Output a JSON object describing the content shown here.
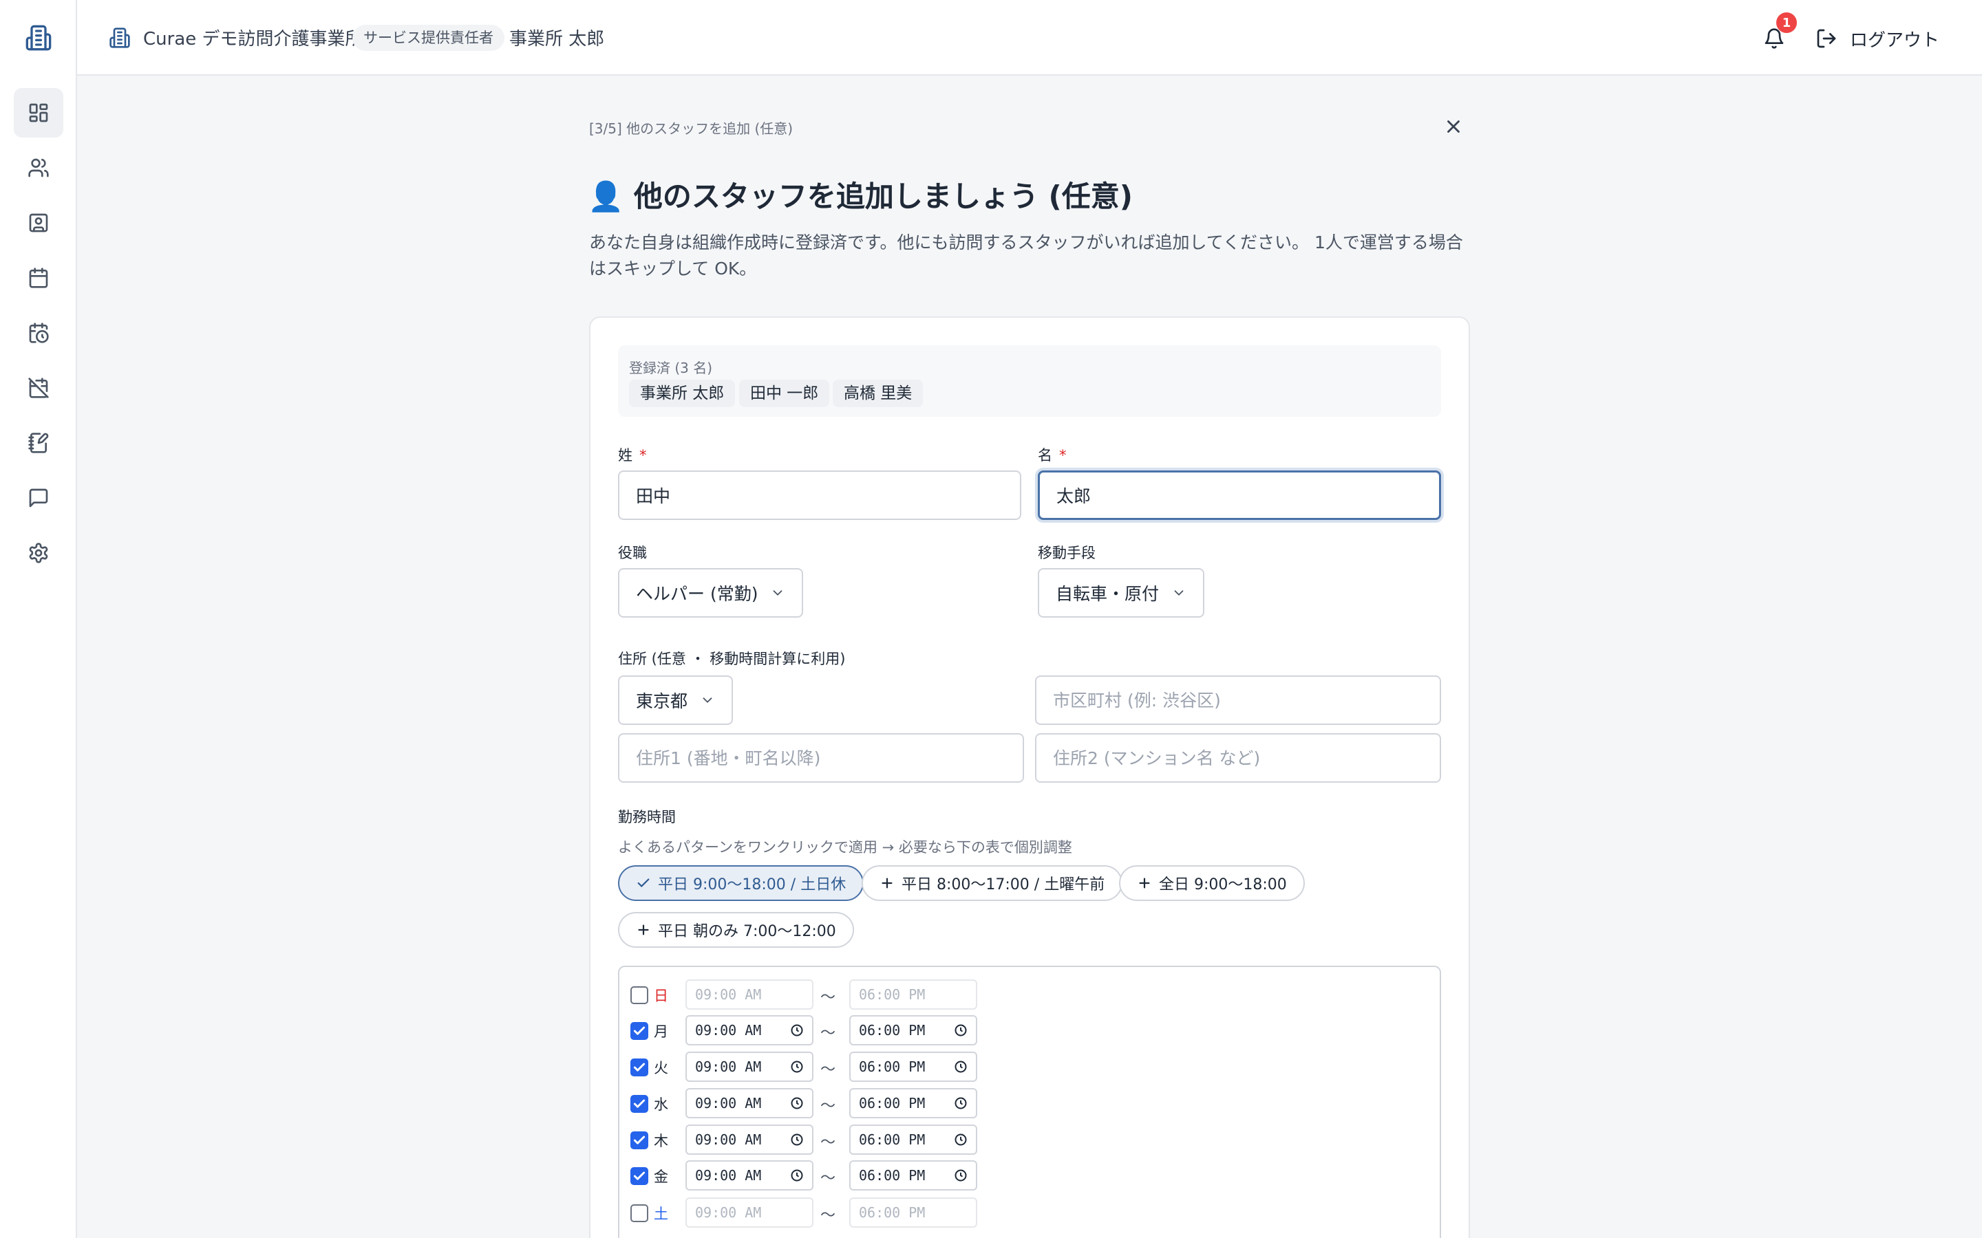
{
  "header": {
    "org_name": "Curae デモ訪問介護事業所",
    "role_badge": "サービス提供責任者",
    "user_name": "事業所 太郎",
    "notification_count": "1",
    "logout_label": "ログアウト"
  },
  "sidebar": {
    "items": [
      {
        "name": "dashboard-icon",
        "active": true
      },
      {
        "name": "users-icon"
      },
      {
        "name": "contact-icon"
      },
      {
        "name": "calendar-icon"
      },
      {
        "name": "calendar-clock-icon"
      },
      {
        "name": "calendar-off-icon"
      },
      {
        "name": "notebook-pen-icon"
      },
      {
        "name": "message-icon"
      },
      {
        "name": "gear-icon"
      }
    ]
  },
  "wizard": {
    "step_label": "[3/5] 他のスタッフを追加 (任意)",
    "title_emoji": "👤",
    "title": "他のスタッフを追加しましょう (任意)",
    "description": "あなた自身は組織作成時に登録済です。他にも訪問するスタッフがいれば追加してください。 1人で運営する場合はスキップして OK。"
  },
  "registered": {
    "label": "登録済 (3 名)",
    "names": [
      "事業所 太郎",
      "田中 一郎",
      "高橋 里美"
    ]
  },
  "form": {
    "last_name_label": "姓",
    "first_name_label": "名",
    "required_mark": "*",
    "last_name_value": "田中",
    "first_name_value": "太郎",
    "role_label": "役職",
    "role_value": "ヘルパー (常勤)",
    "transport_label": "移動手段",
    "transport_value": "自転車・原付",
    "address_label": "住所 (任意 ・ 移動時間計算に利用)",
    "prefecture_value": "東京都",
    "city_placeholder": "市区町村 (例: 渋谷区)",
    "address1_placeholder": "住所1 (番地・町名以降)",
    "address2_placeholder": "住所2 (マンション名 など)",
    "work_hours_label": "勤務時間",
    "work_hours_hint": "よくあるパターンをワンクリックで適用 → 必要なら下の表で個別調整"
  },
  "presets": [
    {
      "label": "平日 9:00〜18:00 / 土日休",
      "selected": true
    },
    {
      "label": "平日 8:00〜17:00 / 土曜午前",
      "selected": false
    },
    {
      "label": "全日 9:00〜18:00",
      "selected": false
    },
    {
      "label": "平日 朝のみ 7:00〜12:00",
      "selected": false
    }
  ],
  "schedule": {
    "separator": "〜",
    "days": [
      {
        "day": "日",
        "checked": false,
        "start": "09:00 AM",
        "end": "06:00 PM"
      },
      {
        "day": "月",
        "checked": true,
        "start": "09:00 AM",
        "end": "06:00 PM"
      },
      {
        "day": "火",
        "checked": true,
        "start": "09:00 AM",
        "end": "06:00 PM"
      },
      {
        "day": "水",
        "checked": true,
        "start": "09:00 AM",
        "end": "06:00 PM"
      },
      {
        "day": "木",
        "checked": true,
        "start": "09:00 AM",
        "end": "06:00 PM"
      },
      {
        "day": "金",
        "checked": true,
        "start": "09:00 AM",
        "end": "06:00 PM"
      },
      {
        "day": "土",
        "checked": false,
        "start": "09:00 AM",
        "end": "06:00 PM"
      }
    ]
  },
  "colors": {
    "accent": "#4a72a8",
    "checkbox": "#2563eb",
    "sunday": "#dc2626",
    "saturday": "#2563eb",
    "badge": "#ef4444"
  }
}
